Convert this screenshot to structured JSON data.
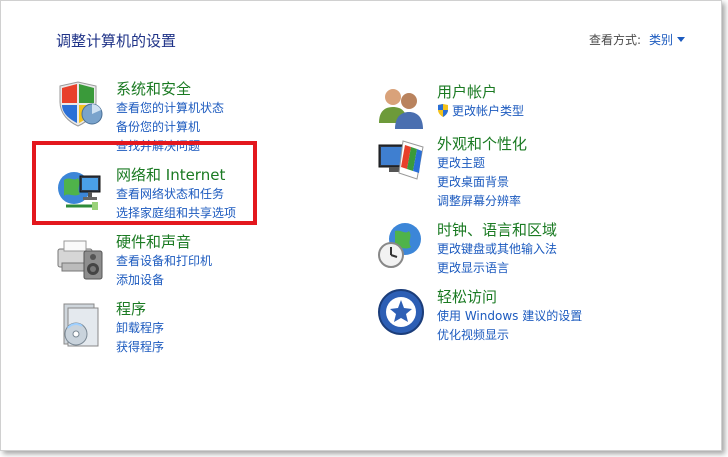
{
  "title": "调整计算机的设置",
  "view_by": {
    "label": "查看方式:",
    "value": "类别"
  },
  "categories_left": [
    {
      "heading": "系统和安全",
      "links": [
        "查看您的计算机状态",
        "备份您的计算机",
        "查找并解决问题"
      ],
      "icon": "shield-icon"
    },
    {
      "heading": "网络和 Internet",
      "links": [
        "查看网络状态和任务",
        "选择家庭组和共享选项"
      ],
      "icon": "network-globe-icon"
    },
    {
      "heading": "硬件和声音",
      "links": [
        "查看设备和打印机",
        "添加设备"
      ],
      "icon": "printer-speaker-icon"
    },
    {
      "heading": "程序",
      "links": [
        "卸载程序",
        "获得程序"
      ],
      "icon": "programs-icon"
    }
  ],
  "categories_right": [
    {
      "heading": "用户帐户",
      "links": [
        "更改帐户类型"
      ],
      "icon": "users-icon"
    },
    {
      "heading": "外观和个性化",
      "links": [
        "更改主题",
        "更改桌面背景",
        "调整屏幕分辨率"
      ],
      "icon": "monitor-palette-icon"
    },
    {
      "heading": "时钟、语言和区域",
      "links": [
        "更改键盘或其他输入法",
        "更改显示语言"
      ],
      "icon": "clock-globe-icon"
    },
    {
      "heading": "轻松访问",
      "links": [
        "使用 Windows 建议的设置",
        "优化视频显示"
      ],
      "icon": "ease-of-access-icon"
    }
  ],
  "colors": {
    "heading": "#1a7a22",
    "link": "#1d5bbf",
    "title": "#1e3287",
    "highlight": "#e3171d"
  }
}
